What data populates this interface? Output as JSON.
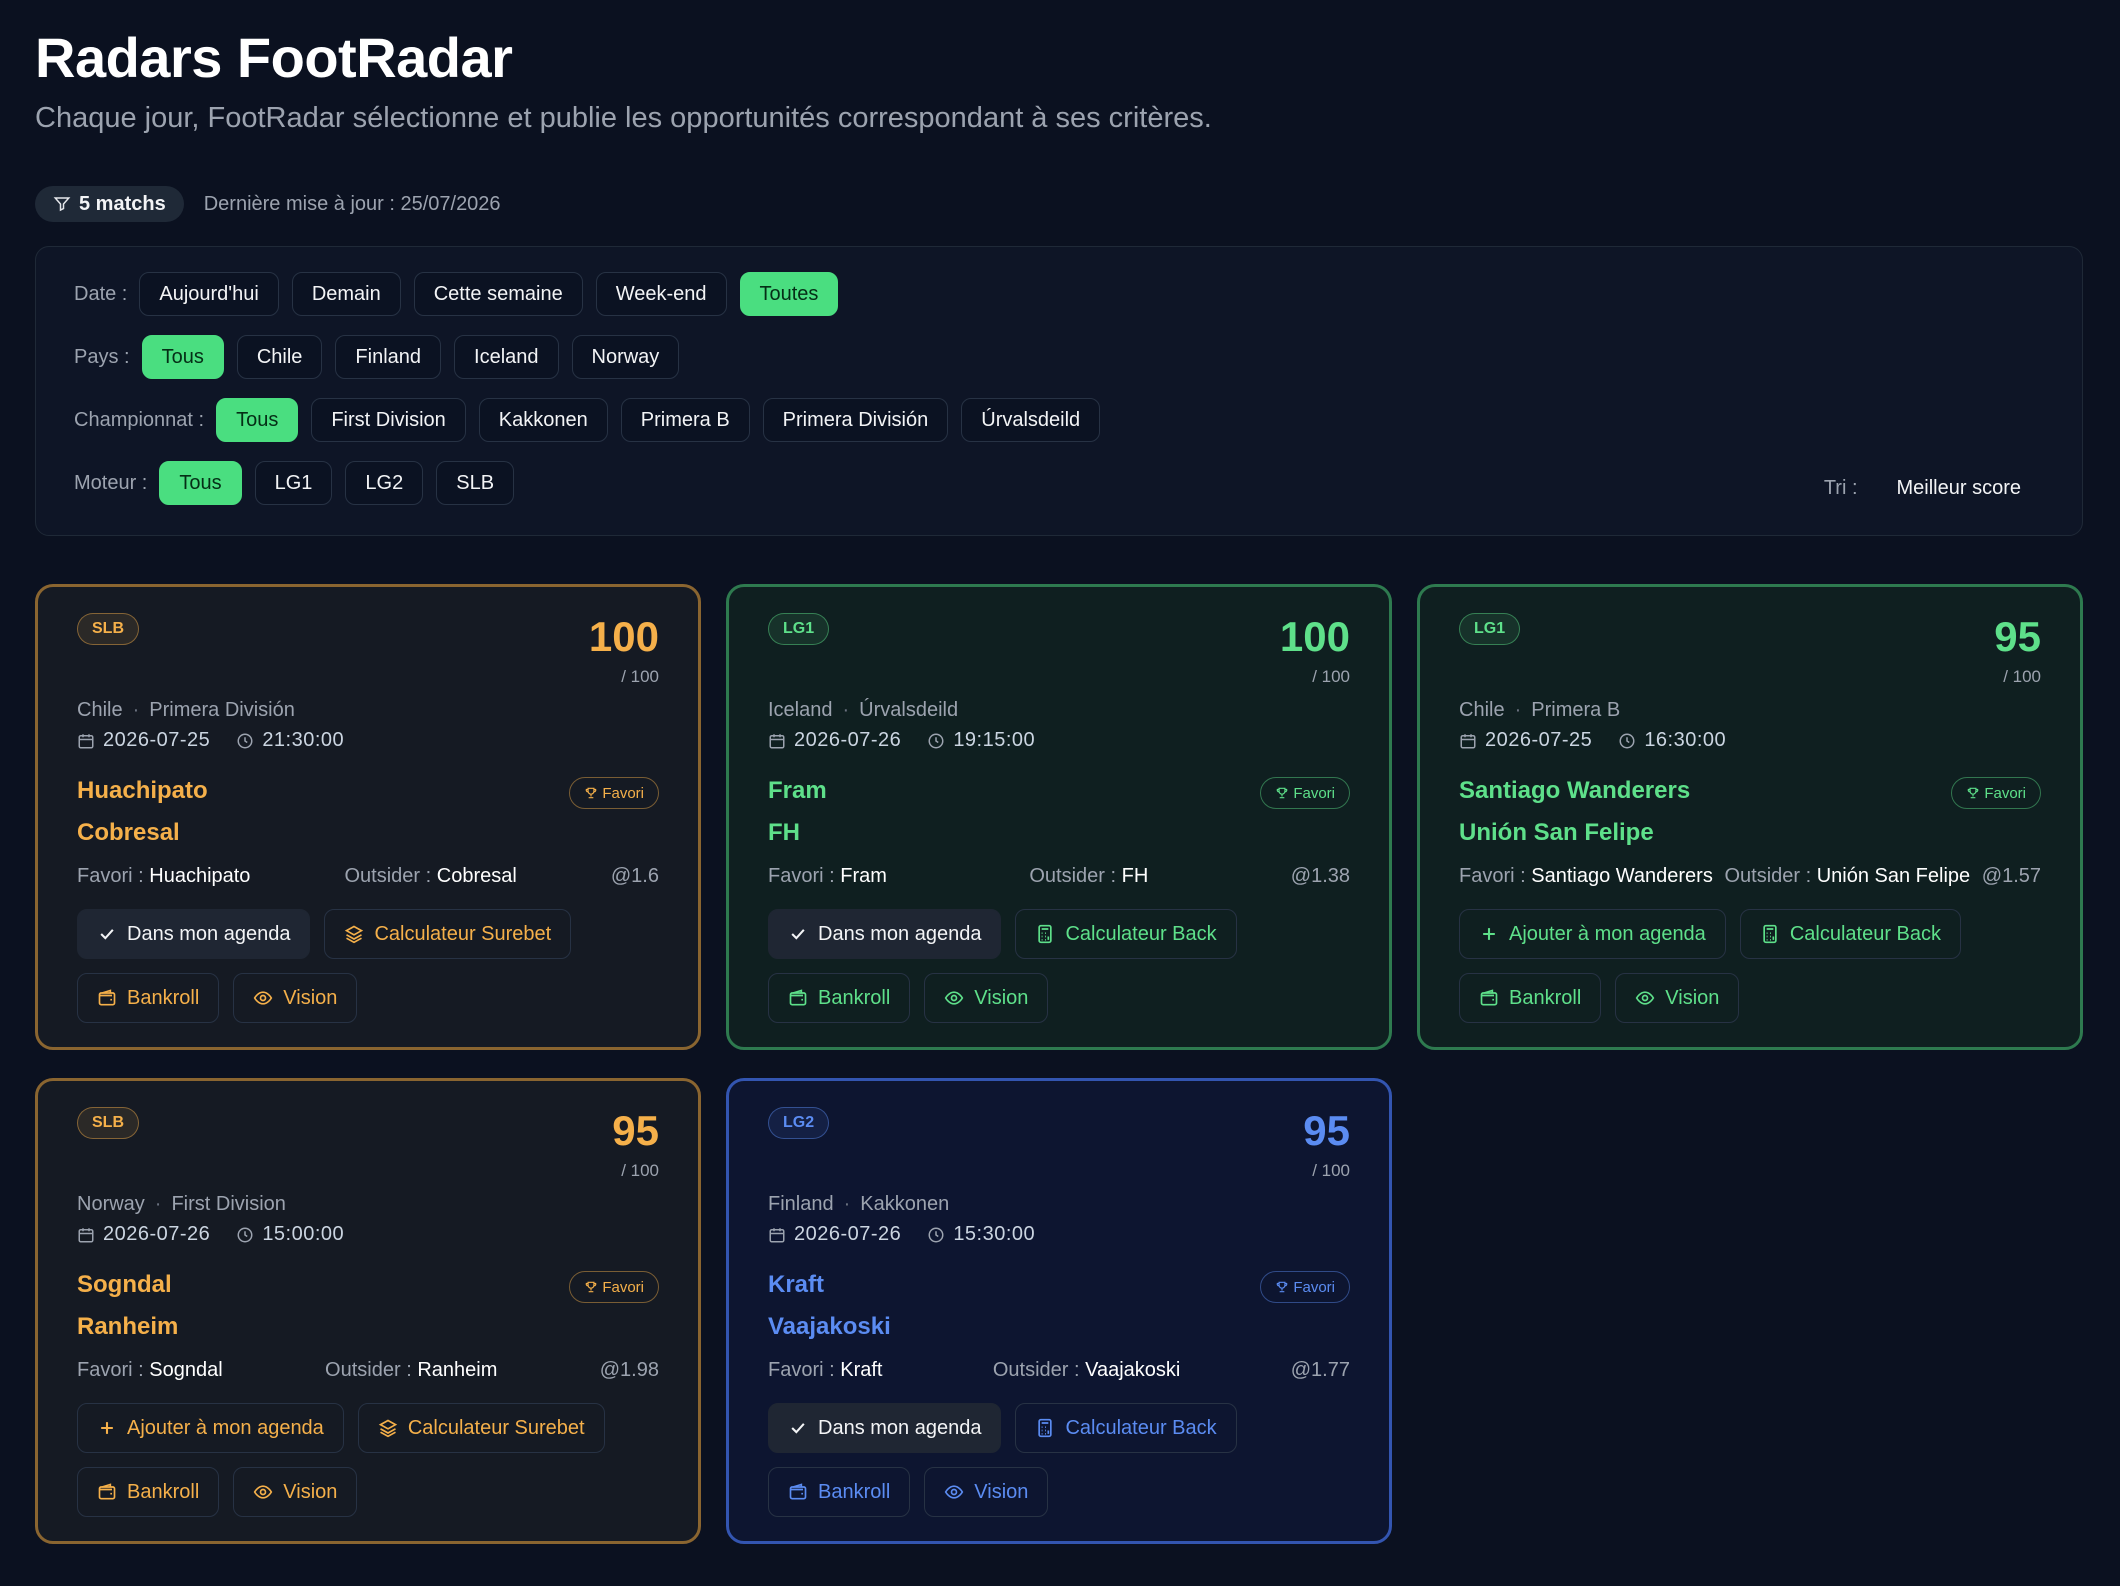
{
  "header": {
    "title": "Radars FootRadar",
    "subtitle": "Chaque jour, FootRadar sélectionne et publie les opportunités correspondant à ses critères."
  },
  "meta": {
    "count": "5 matchs",
    "updated": "Dernière mise à jour : 25/07/2026"
  },
  "filters": {
    "date_label": "Date :",
    "date_options": [
      "Aujourd'hui",
      "Demain",
      "Cette semaine",
      "Week-end",
      "Toutes"
    ],
    "country_label": "Pays :",
    "country_options": [
      "Tous",
      "Chile",
      "Finland",
      "Iceland",
      "Norway"
    ],
    "league_label": "Championnat :",
    "league_options": [
      "Tous",
      "First Division",
      "Kakkonen",
      "Primera B",
      "Primera División",
      "Úrvalsdeild"
    ],
    "engine_label": "Moteur :",
    "engine_options": [
      "Tous",
      "LG1",
      "LG2",
      "SLB"
    ],
    "sort_label": "Tri :",
    "sort_value": "Meilleur score"
  },
  "common": {
    "score_max": "/ 100",
    "fav_badge": "Favori",
    "fav_label": "Favori :",
    "out_label": "Outsider :",
    "agenda_done": "Dans mon agenda",
    "agenda_add": "Ajouter à mon agenda",
    "bankroll": "Bankroll",
    "vision": "Vision"
  },
  "cards": [
    {
      "engine": "SLB",
      "score": "100",
      "country": "Chile",
      "league": "Primera División",
      "date": "2026-07-25",
      "time": "21:30:00",
      "home": "Huachipato",
      "away": "Cobresal",
      "favorite": "Huachipato",
      "outsider": "Cobresal",
      "odds": "@1.6",
      "agenda": "Dans mon agenda",
      "calc": "Calculateur Surebet"
    },
    {
      "engine": "LG1",
      "score": "100",
      "country": "Iceland",
      "league": "Úrvalsdeild",
      "date": "2026-07-26",
      "time": "19:15:00",
      "home": "Fram",
      "away": "FH",
      "favorite": "Fram",
      "outsider": "FH",
      "odds": "@1.38",
      "agenda": "Dans mon agenda",
      "calc": "Calculateur Back"
    },
    {
      "engine": "LG1",
      "score": "95",
      "country": "Chile",
      "league": "Primera B",
      "date": "2026-07-25",
      "time": "16:30:00",
      "home": "Santiago Wanderers",
      "away": "Unión San Felipe",
      "favorite": "Santiago Wanderers",
      "outsider": "Unión San Felipe",
      "odds": "@1.57",
      "agenda": "Ajouter à mon agenda",
      "calc": "Calculateur Back"
    },
    {
      "engine": "SLB",
      "score": "95",
      "country": "Norway",
      "league": "First Division",
      "date": "2026-07-26",
      "time": "15:00:00",
      "home": "Sogndal",
      "away": "Ranheim",
      "favorite": "Sogndal",
      "outsider": "Ranheim",
      "odds": "@1.98",
      "agenda": "Ajouter à mon agenda",
      "calc": "Calculateur Surebet"
    },
    {
      "engine": "LG2",
      "score": "95",
      "country": "Finland",
      "league": "Kakkonen",
      "date": "2026-07-26",
      "time": "15:30:00",
      "home": "Kraft",
      "away": "Vaajakoski",
      "favorite": "Kraft",
      "outsider": "Vaajakoski",
      "odds": "@1.77",
      "agenda": "Dans mon agenda",
      "calc": "Calculateur Back"
    }
  ],
  "colors": {
    "SLB": "#f5b04a",
    "LG1": "#5ee08a",
    "LG2": "#5b8cf2",
    "active_chip": "#4ade80"
  }
}
